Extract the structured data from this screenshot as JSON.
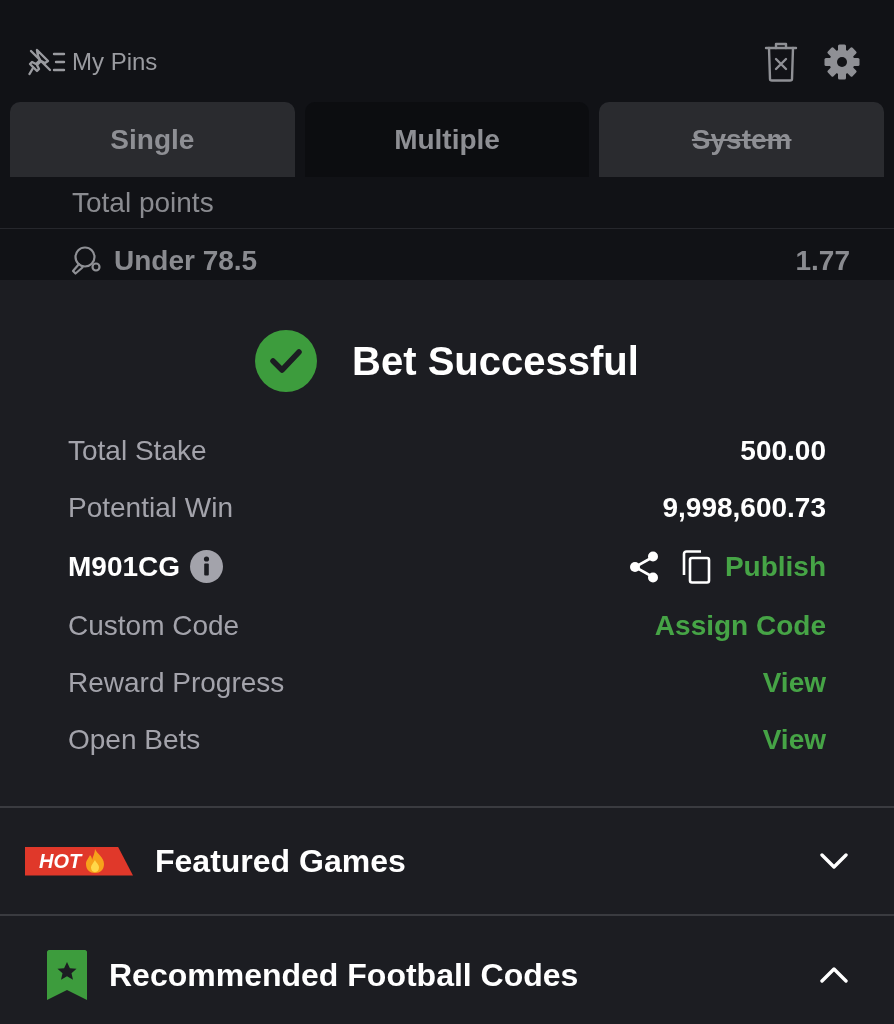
{
  "header": {
    "title": "My Pins"
  },
  "tabs": [
    {
      "label": "Single",
      "selected": false,
      "disabled": false
    },
    {
      "label": "Multiple",
      "selected": true,
      "disabled": false
    },
    {
      "label": "System",
      "selected": false,
      "disabled": true
    }
  ],
  "selection": {
    "market": "Total points",
    "pick": "Under 78.5",
    "odds": "1.77"
  },
  "confirmation": {
    "title": "Bet Successful",
    "rows": [
      {
        "kind": "value",
        "label": "Total Stake",
        "value": "500.00"
      },
      {
        "kind": "value",
        "label": "Potential Win",
        "value": "9,998,600.73"
      },
      {
        "kind": "code",
        "label": "M901CG",
        "value": "Publish"
      },
      {
        "kind": "link",
        "label": "Custom Code",
        "value": "Assign Code"
      },
      {
        "kind": "link",
        "label": "Reward Progress",
        "value": "View"
      },
      {
        "kind": "link",
        "label": "Open Bets",
        "value": "View"
      }
    ]
  },
  "sections": [
    {
      "kind": "hot",
      "badge": "HOT",
      "title": "Featured Games",
      "expanded": false
    },
    {
      "kind": "bookmark",
      "title": "Recommended Football Codes",
      "expanded": true
    }
  ]
}
